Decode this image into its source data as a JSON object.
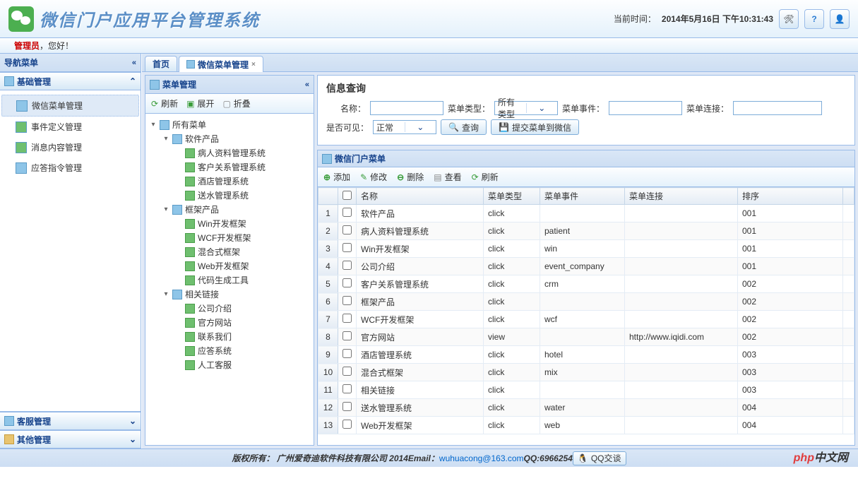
{
  "header": {
    "title": "微信门户应用平台管理系统",
    "time_label": "当前时间：",
    "time_value": "2014年5月16日 下午10:31:43"
  },
  "userbar": {
    "admin": "管理员",
    "greet": "，您好！"
  },
  "sidebar": {
    "title": "导航菜单",
    "groups": [
      {
        "label": "基础管理",
        "expanded": true,
        "items": [
          {
            "label": "微信菜单管理",
            "active": true
          },
          {
            "label": "事件定义管理"
          },
          {
            "label": "消息内容管理"
          },
          {
            "label": "应答指令管理"
          }
        ]
      },
      {
        "label": "客服管理",
        "expanded": false
      },
      {
        "label": "其他管理",
        "expanded": false
      }
    ]
  },
  "tabs": [
    {
      "label": "首页",
      "closable": false
    },
    {
      "label": "微信菜单管理",
      "closable": true,
      "active": true
    }
  ],
  "tree_panel": {
    "title": "菜单管理",
    "toolbar": {
      "refresh": "刷新",
      "expand": "展开",
      "collapse": "折叠"
    },
    "root": "所有菜单",
    "nodes": [
      {
        "label": "软件产品",
        "children": [
          "病人资料管理系统",
          "客户关系管理系统",
          "酒店管理系统",
          "送水管理系统"
        ]
      },
      {
        "label": "框架产品",
        "children": [
          "Win开发框架",
          "WCF开发框架",
          "混合式框架",
          "Web开发框架",
          "代码生成工具"
        ]
      },
      {
        "label": "相关链接",
        "children": [
          "公司介绍",
          "官方网站",
          "联系我们",
          "应答系统",
          "人工客服"
        ]
      }
    ]
  },
  "form": {
    "title": "信息查询",
    "name_label": "名称：",
    "type_label": "菜单类型：",
    "type_value": "所有类型",
    "event_label": "菜单事件：",
    "link_label": "菜单连接：",
    "visible_label": "是否可见：",
    "visible_value": "正常",
    "btn_query": "查询",
    "btn_submit": "提交菜单到微信"
  },
  "grid": {
    "title": "微信门户菜单",
    "toolbar": {
      "add": "添加",
      "edit": "修改",
      "del": "删除",
      "view": "查看",
      "refresh": "刷新"
    },
    "columns": [
      "名称",
      "菜单类型",
      "菜单事件",
      "菜单连接",
      "排序"
    ],
    "rows": [
      [
        "软件产品",
        "click",
        "",
        "",
        "001"
      ],
      [
        "病人资料管理系统",
        "click",
        "patient",
        "",
        "001"
      ],
      [
        "Win开发框架",
        "click",
        "win",
        "",
        "001"
      ],
      [
        "公司介绍",
        "click",
        "event_company",
        "",
        "001"
      ],
      [
        "客户关系管理系统",
        "click",
        "crm",
        "",
        "002"
      ],
      [
        "框架产品",
        "click",
        "",
        "",
        "002"
      ],
      [
        "WCF开发框架",
        "click",
        "wcf",
        "",
        "002"
      ],
      [
        "官方网站",
        "view",
        "",
        "http://www.iqidi.com",
        "002"
      ],
      [
        "酒店管理系统",
        "click",
        "hotel",
        "",
        "003"
      ],
      [
        "混合式框架",
        "click",
        "mix",
        "",
        "003"
      ],
      [
        "相关链接",
        "click",
        "",
        "",
        "003"
      ],
      [
        "送水管理系统",
        "click",
        "water",
        "",
        "004"
      ],
      [
        "Web开发框架",
        "click",
        "web",
        "",
        "004"
      ]
    ]
  },
  "footer": {
    "copyright": "版权所有：",
    "company": "广州爱奇迪软件科技有限公司 2014",
    "email_label": " Email：",
    "email": "wuhuacong@163.com",
    "qq_label": " QQ:6966254 ",
    "qq_btn": "QQ交谈"
  }
}
